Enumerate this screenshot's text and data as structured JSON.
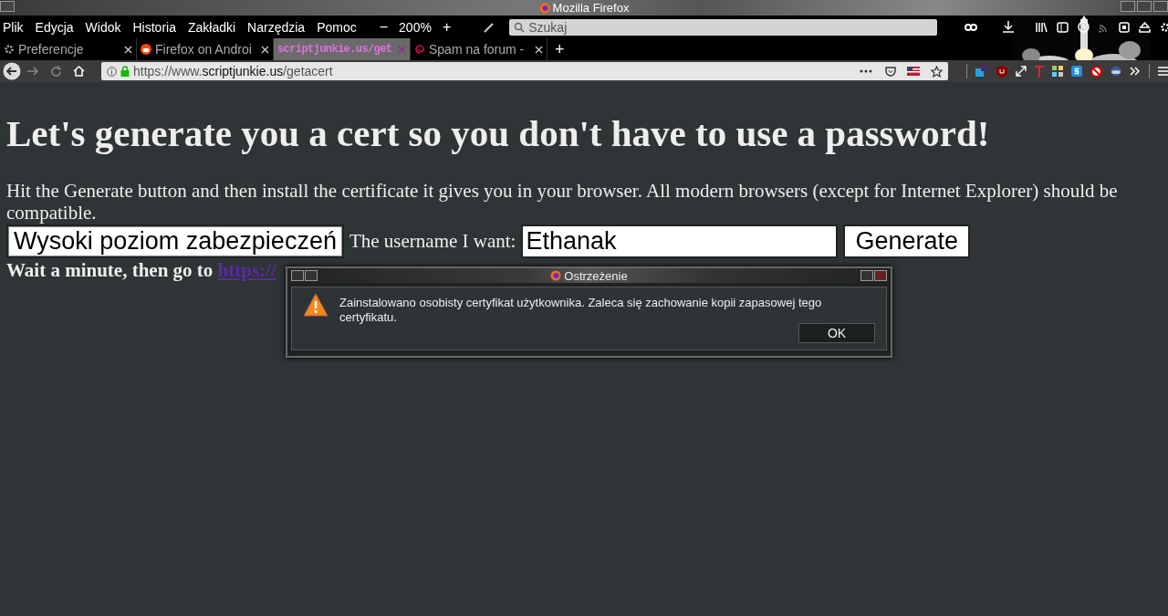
{
  "window": {
    "title": "Mozilla Firefox"
  },
  "menu_bar": {
    "items": [
      "Plik",
      "Edycja",
      "Widok",
      "Historia",
      "Zakładki",
      "Narzędzia",
      "Pomoc"
    ],
    "zoom": {
      "minus": "−",
      "level": "200%",
      "plus": "+"
    },
    "search": {
      "placeholder": "Szukaj"
    }
  },
  "tabs": [
    {
      "label": "Preferencje",
      "kind": "gear",
      "selected": false
    },
    {
      "label": "Firefox on Androi",
      "kind": "reddit",
      "selected": false
    },
    {
      "label": "scriptjunkie.us/get",
      "kind": "none",
      "selected": true
    },
    {
      "label": "Spam na forum -",
      "kind": "swirl",
      "selected": false
    }
  ],
  "new_tab": "+",
  "address": {
    "scheme": "https://www.",
    "domain": "scriptjunkie.us",
    "path": "/getacert"
  },
  "page": {
    "heading": "Let's generate you a cert so you don't have to use a password!",
    "intro": "Hit the Generate button and then install the certificate it gives you in your browser. All modern browsers (except for Internet Explorer) should be compatible.",
    "key_strength": "Wysoki poziom zabezpieczeń",
    "username_label": "The username I want:",
    "username": "Ethanak",
    "generate": "Generate",
    "wait_text": "Wait a minute, then go to",
    "link": "https://"
  },
  "dialog": {
    "title": "Ostrzeżenie",
    "message": "Zainstalowano osobisty certyfikat użytkownika. Zaleca się zachowanie kopii zapasowej tego certyfikatu.",
    "button": "OK"
  }
}
